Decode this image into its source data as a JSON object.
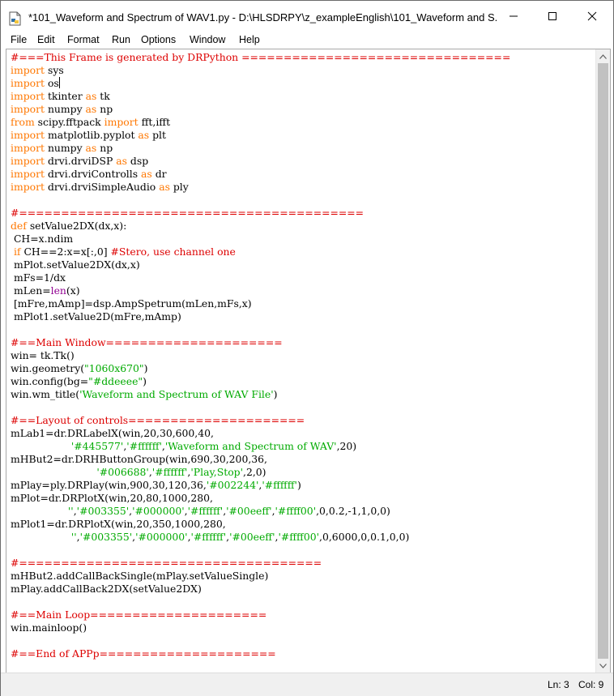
{
  "window": {
    "title": "*101_Waveform and Spectrum of WAV1.py - D:\\HLSDRPY\\z_exampleEnglish\\101_Waveform and S...",
    "app_icon": "python-file-icon",
    "controls": [
      "minimize-icon",
      "maximize-icon",
      "close-icon"
    ]
  },
  "menu": [
    "File",
    "Edit",
    "Format",
    "Run",
    "Options",
    "Window",
    "Help"
  ],
  "colors": {
    "comment": "#dd0000",
    "keyword": "#ff7700",
    "builtin": "#900090",
    "string": "#00aa00",
    "definition": "#0000ff"
  },
  "code_lines": [
    [
      [
        "comment",
        "#===This Frame is generated by DRPython ================================"
      ]
    ],
    [
      [
        "keyword",
        "import"
      ],
      [
        "text",
        " sys"
      ]
    ],
    [
      [
        "keyword",
        "import"
      ],
      [
        "text",
        " os"
      ]
    ],
    [
      [
        "keyword",
        "import"
      ],
      [
        "text",
        " tkinter "
      ],
      [
        "keyword",
        "as"
      ],
      [
        "text",
        " tk"
      ]
    ],
    [
      [
        "keyword",
        "import"
      ],
      [
        "text",
        " numpy "
      ],
      [
        "keyword",
        "as"
      ],
      [
        "text",
        " np"
      ]
    ],
    [
      [
        "keyword",
        "from"
      ],
      [
        "text",
        " scipy.fftpack "
      ],
      [
        "keyword",
        "import"
      ],
      [
        "text",
        " fft,ifft"
      ]
    ],
    [
      [
        "keyword",
        "import"
      ],
      [
        "text",
        " matplotlib.pyplot "
      ],
      [
        "keyword",
        "as"
      ],
      [
        "text",
        " plt"
      ]
    ],
    [
      [
        "keyword",
        "import"
      ],
      [
        "text",
        " numpy "
      ],
      [
        "keyword",
        "as"
      ],
      [
        "text",
        " np"
      ]
    ],
    [
      [
        "keyword",
        "import"
      ],
      [
        "text",
        " drvi.drviDSP "
      ],
      [
        "keyword",
        "as"
      ],
      [
        "text",
        " dsp"
      ]
    ],
    [
      [
        "keyword",
        "import"
      ],
      [
        "text",
        " drvi.drviControlls "
      ],
      [
        "keyword",
        "as"
      ],
      [
        "text",
        " dr"
      ]
    ],
    [
      [
        "keyword",
        "import"
      ],
      [
        "text",
        " drvi.drviSimpleAudio "
      ],
      [
        "keyword",
        "as"
      ],
      [
        "text",
        " ply"
      ]
    ],
    [],
    [
      [
        "comment",
        "#========================================="
      ]
    ],
    [
      [
        "keyword",
        "def"
      ],
      [
        "text",
        " "
      ],
      [
        "definition",
        "setValue2DX"
      ],
      [
        "text",
        "(dx,x):"
      ]
    ],
    [
      [
        "text",
        " CH=x.ndim"
      ]
    ],
    [
      [
        "text",
        " "
      ],
      [
        "keyword",
        "if"
      ],
      [
        "text",
        " CH==2:x=x[:,0] "
      ],
      [
        "comment",
        "#Stero, use channel one"
      ]
    ],
    [
      [
        "text",
        " mPlot.setValue2DX(dx,x)"
      ]
    ],
    [
      [
        "text",
        " mFs=1/dx"
      ]
    ],
    [
      [
        "text",
        " mLen="
      ],
      [
        "builtin",
        "len"
      ],
      [
        "text",
        "(x)"
      ]
    ],
    [
      [
        "text",
        " [mFre,mAmp]=dsp.AmpSpetrum(mLen,mFs,x)"
      ]
    ],
    [
      [
        "text",
        " mPlot1.setValue2D(mFre,mAmp)"
      ]
    ],
    [],
    [
      [
        "comment",
        "#==Main Window====================="
      ]
    ],
    [
      [
        "text",
        "win= tk.Tk()"
      ]
    ],
    [
      [
        "text",
        "win.geometry("
      ],
      [
        "string",
        "\"1060x670\""
      ],
      [
        "text",
        ")"
      ]
    ],
    [
      [
        "text",
        "win.config(bg="
      ],
      [
        "string",
        "\"#ddeeee\""
      ],
      [
        "text",
        ")"
      ]
    ],
    [
      [
        "text",
        "win.wm_title("
      ],
      [
        "string",
        "'Waveform and Spectrum of WAV File'"
      ],
      [
        "text",
        ")"
      ]
    ],
    [],
    [
      [
        "comment",
        "#==Layout of controls====================="
      ]
    ],
    [
      [
        "text",
        "mLab1=dr.DRLabelX(win,20,30,600,40,"
      ]
    ],
    [
      [
        "text",
        "                   "
      ],
      [
        "string",
        "'#445577'"
      ],
      [
        "text",
        ","
      ],
      [
        "string",
        "'#ffffff'"
      ],
      [
        "text",
        ","
      ],
      [
        "string",
        "'Waveform and Spectrum of WAV'"
      ],
      [
        "text",
        ",20)"
      ]
    ],
    [
      [
        "text",
        "mHBut2=dr.DRHButtonGroup(win,690,30,200,36,"
      ]
    ],
    [
      [
        "text",
        "                           "
      ],
      [
        "string",
        "'#006688'"
      ],
      [
        "text",
        ","
      ],
      [
        "string",
        "'#ffffff'"
      ],
      [
        "text",
        ","
      ],
      [
        "string",
        "'Play,Stop'"
      ],
      [
        "text",
        ",2,0)"
      ]
    ],
    [
      [
        "text",
        "mPlay=ply.DRPlay(win,900,30,120,36,"
      ],
      [
        "string",
        "'#002244'"
      ],
      [
        "text",
        ","
      ],
      [
        "string",
        "'#ffffff'"
      ],
      [
        "text",
        ")"
      ]
    ],
    [
      [
        "text",
        "mPlot=dr.DRPlotX(win,20,80,1000,280,"
      ]
    ],
    [
      [
        "text",
        "                  "
      ],
      [
        "string",
        "''"
      ],
      [
        "text",
        ","
      ],
      [
        "string",
        "'#003355'"
      ],
      [
        "text",
        ","
      ],
      [
        "string",
        "'#000000'"
      ],
      [
        "text",
        ","
      ],
      [
        "string",
        "'#ffffff'"
      ],
      [
        "text",
        ","
      ],
      [
        "string",
        "'#00eeff'"
      ],
      [
        "text",
        ","
      ],
      [
        "string",
        "'#ffff00'"
      ],
      [
        "text",
        ",0,0.2,-1,1,0,0)"
      ]
    ],
    [
      [
        "text",
        "mPlot1=dr.DRPlotX(win,20,350,1000,280,"
      ]
    ],
    [
      [
        "text",
        "                   "
      ],
      [
        "string",
        "''"
      ],
      [
        "text",
        ","
      ],
      [
        "string",
        "'#003355'"
      ],
      [
        "text",
        ","
      ],
      [
        "string",
        "'#000000'"
      ],
      [
        "text",
        ","
      ],
      [
        "string",
        "'#ffffff'"
      ],
      [
        "text",
        ","
      ],
      [
        "string",
        "'#00eeff'"
      ],
      [
        "text",
        ","
      ],
      [
        "string",
        "'#ffff00'"
      ],
      [
        "text",
        ",0,6000,0,0.1,0,0)"
      ]
    ],
    [],
    [
      [
        "comment",
        "#===================================="
      ]
    ],
    [
      [
        "text",
        "mHBut2.addCallBackSingle(mPlay.setValueSingle)"
      ]
    ],
    [
      [
        "text",
        "mPlay.addCallBack2DX(setValue2DX)"
      ]
    ],
    [],
    [
      [
        "comment",
        "#==Main Loop====================="
      ]
    ],
    [
      [
        "text",
        "win.mainloop()"
      ]
    ],
    [],
    [
      [
        "comment",
        "#==End of APPp====================="
      ]
    ]
  ],
  "cursor": {
    "line": 3,
    "col": 9
  },
  "status": {
    "ln_label": "Ln: 3",
    "col_label": "Col: 9"
  }
}
